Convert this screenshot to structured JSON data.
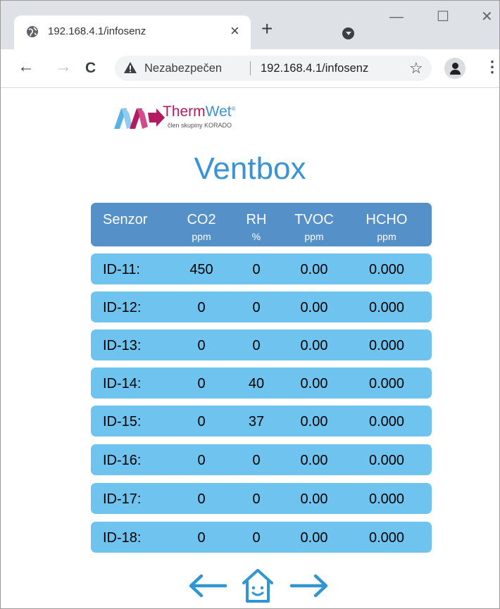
{
  "browser": {
    "tab_title": "192.168.4.1/infosenz",
    "tab_close": "×",
    "new_tab": "+",
    "window_minimize": "—",
    "window_maximize": "☐",
    "window_close": "✕",
    "nav_back": "←",
    "nav_forward": "→",
    "nav_reload": "C",
    "security_label": "Nezabezpečen",
    "url": "192.168.4.1/infosenz",
    "bookmark_star": "☆",
    "menu": "⋮"
  },
  "logo": {
    "brand_a": "Therm",
    "brand_b": "Wet",
    "brand_mark": "®",
    "tagline": "člen skupiny KORADO",
    "colors": {
      "magenta": "#b01b61",
      "blue": "#3a93d6"
    }
  },
  "page": {
    "title": "Ventbox"
  },
  "table": {
    "headers": [
      {
        "label": "Senzor",
        "unit": ""
      },
      {
        "label": "CO2",
        "unit": "ppm"
      },
      {
        "label": "RH",
        "unit": "%"
      },
      {
        "label": "TVOC",
        "unit": "ppm"
      },
      {
        "label": "HCHO",
        "unit": "ppm"
      }
    ],
    "rows": [
      {
        "id": "ID-11:",
        "co2": "450",
        "rh": "0",
        "tvoc": "0.00",
        "hcho": "0.000"
      },
      {
        "id": "ID-12:",
        "co2": "0",
        "rh": "0",
        "tvoc": "0.00",
        "hcho": "0.000"
      },
      {
        "id": "ID-13:",
        "co2": "0",
        "rh": "0",
        "tvoc": "0.00",
        "hcho": "0.000"
      },
      {
        "id": "ID-14:",
        "co2": "0",
        "rh": "40",
        "tvoc": "0.00",
        "hcho": "0.000"
      },
      {
        "id": "ID-15:",
        "co2": "0",
        "rh": "37",
        "tvoc": "0.00",
        "hcho": "0.000"
      },
      {
        "id": "ID-16:",
        "co2": "0",
        "rh": "0",
        "tvoc": "0.00",
        "hcho": "0.000"
      },
      {
        "id": "ID-17:",
        "co2": "0",
        "rh": "0",
        "tvoc": "0.00",
        "hcho": "0.000"
      },
      {
        "id": "ID-18:",
        "co2": "0",
        "rh": "0",
        "tvoc": "0.00",
        "hcho": "0.000"
      }
    ]
  },
  "footer_nav": {
    "icons": [
      "arrow-left-icon",
      "home-icon",
      "arrow-right-icon"
    ],
    "color": "#2f96d4"
  },
  "colors": {
    "header_bg": "#5590c8",
    "row_bg": "#6ec4ef",
    "title": "#3a93d6"
  }
}
